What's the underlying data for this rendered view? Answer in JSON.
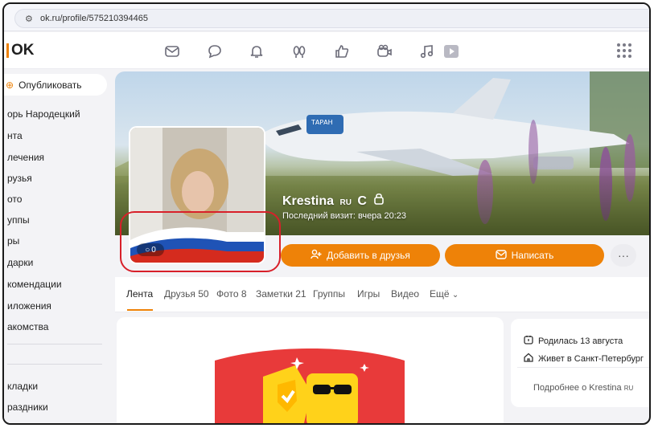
{
  "browser": {
    "url": "ok.ru/profile/575210394465"
  },
  "topnav": {
    "logo": "OK"
  },
  "sidebar": {
    "publish_label": "Опубликовать",
    "items": [
      "орь Народецкий",
      "нта",
      "лечения",
      "рузья",
      "ото",
      "уппы",
      "ры",
      "дарки",
      "комендации",
      "иложения",
      "акомства",
      "кладки",
      "раздники"
    ]
  },
  "profile": {
    "name": "Krestina",
    "name_badge": "RU",
    "name_suffix": "C",
    "last_visit": "Последний визит: вчера 20:23",
    "photo_comments": "0",
    "add_friend_label": "Добавить в друзья",
    "write_label": "Написать",
    "more_label": "···"
  },
  "tabs": [
    "Лента",
    "Друзья 50",
    "Фото 8",
    "Заметки 21",
    "Группы",
    "Игры",
    "Видео",
    "Ещё"
  ],
  "info": {
    "birthday": "Родилась 13 августа",
    "lives": "Живет в Санкт-Петербург",
    "more": "Подробнее о Krestina",
    "more_badge": "RU"
  }
}
